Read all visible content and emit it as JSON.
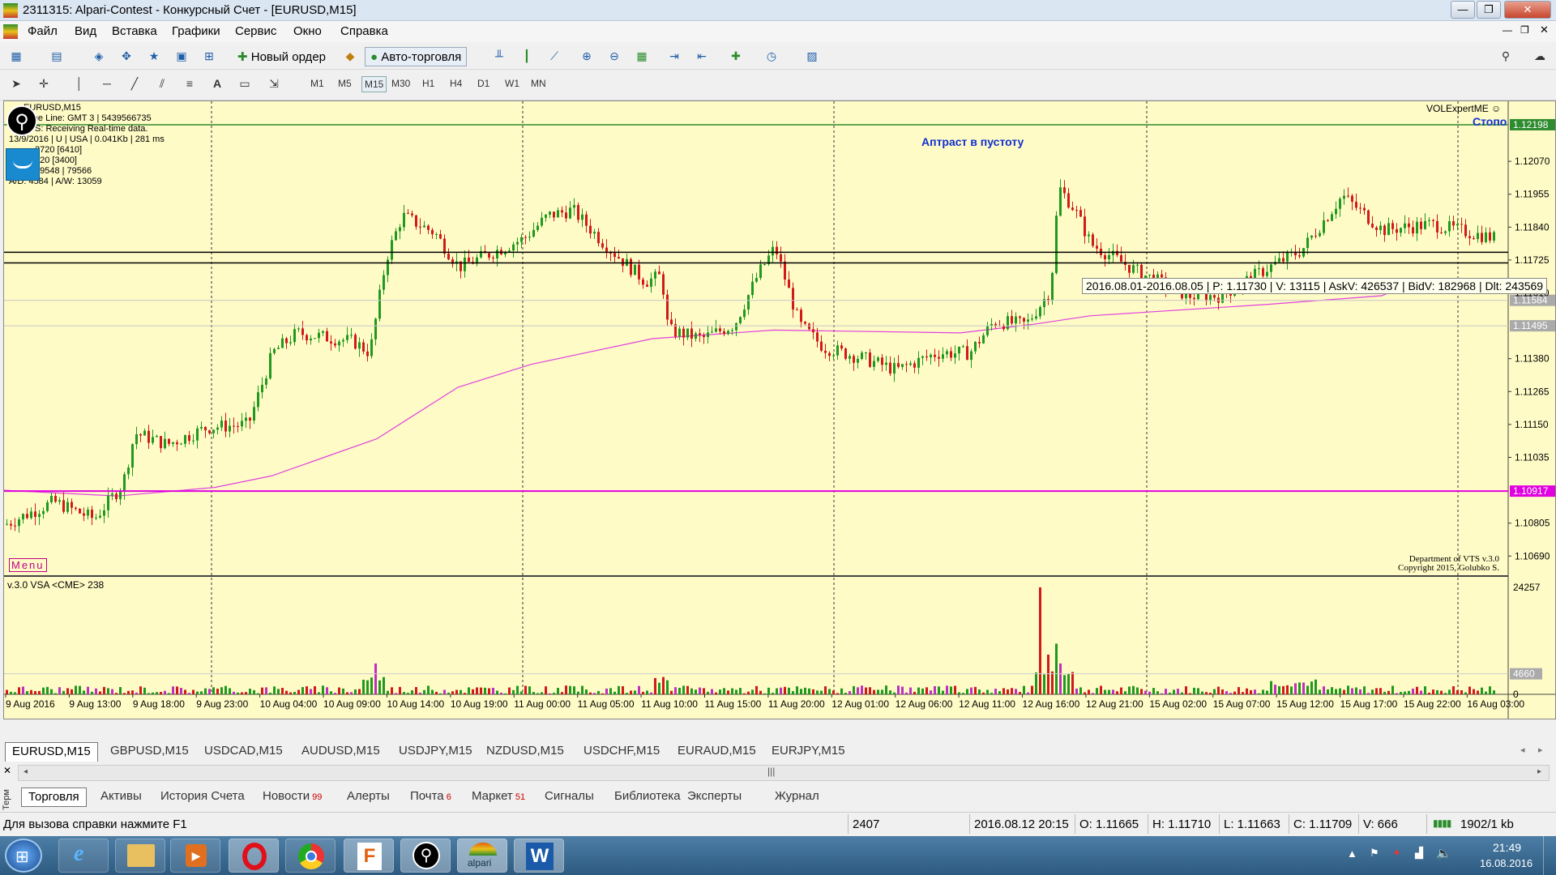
{
  "window": {
    "title": "2311315: Alpari-Contest - Конкурсный Счет - [EURUSD,M15]",
    "controls": [
      "—",
      "❐",
      "✕"
    ]
  },
  "menu": [
    "Файл",
    "Вид",
    "Вставка",
    "Графики",
    "Сервис",
    "Окно",
    "Справка"
  ],
  "toolbar": {
    "new_order": "Новый ордер",
    "auto_trading": "Авто-торговля",
    "timeframes": [
      "M1",
      "M5",
      "M15",
      "M30",
      "H1",
      "H4",
      "D1",
      "W1",
      "MN"
    ],
    "selected_timeframe": "M15",
    "text_tool": "A"
  },
  "chart": {
    "symbol_header": "EURUSD,M15",
    "info_lines": [
      "Time Line: GMT 3 | 5439566735",
      "VTS:  Receiving Real-time data.",
      "13/9/2016 | U | USA | 0.041Kb | 281 ms",
      "2720  [6410]",
      "620  [3400]",
      "99548 | 79566",
      "A/D: 4584 | A/W: 13059"
    ],
    "menu_label": "Menu",
    "top_right_label": "VOLExpertME ☺",
    "stop_label": "Стопо",
    "annotation": "Аптраст в пустоту",
    "tooltip": "2016.08.01-2016.08.05 | P: 1.11730 | V: 13115 | AskV: 426537 | BidV: 182968 | Dlt: 243569",
    "copyright_1": "Department of VTS  v.3.0",
    "copyright_2": "Copyright 2015, Golubko S.",
    "indicator_label": "v.3.0 VSA <CME> 238",
    "price_labels": [
      "1.12070",
      "1.11955",
      "1.11840",
      "1.11725",
      "1.11610",
      "1.11380",
      "1.11265",
      "1.11150",
      "1.11035",
      "1.10805",
      "1.10690"
    ],
    "highlight_prices": {
      "top_line": "1.12198",
      "magenta_line": "1.10917",
      "grey_1": "1.11584",
      "grey_2": "1.11495"
    },
    "volume_labels": [
      "24257",
      "4660",
      "0"
    ],
    "time_labels": [
      "9 Aug 2016",
      "9 Aug 13:00",
      "9 Aug 18:00",
      "9 Aug 23:00",
      "10 Aug 04:00",
      "10 Aug 09:00",
      "10 Aug 14:00",
      "10 Aug 19:00",
      "11 Aug 00:00",
      "11 Aug 05:00",
      "11 Aug 10:00",
      "11 Aug 15:00",
      "11 Aug 20:00",
      "12 Aug 01:00",
      "12 Aug 06:00",
      "12 Aug 11:00",
      "12 Aug 16:00",
      "12 Aug 21:00",
      "15 Aug 02:00",
      "15 Aug 07:00",
      "15 Aug 12:00",
      "15 Aug 17:00",
      "15 Aug 22:00",
      "16 Aug 03:00"
    ],
    "colors": {
      "background": "#fffbc6",
      "bull": "#1f9a1f",
      "bear": "#d11a1a",
      "ma": "#e040e0",
      "magenta_line": "#e000e0",
      "top_line": "#2e8b2e",
      "annotation": "#1030d0"
    }
  },
  "chart_tabs": [
    "EURUSD,M15",
    "GBPUSD,M15",
    "USDCAD,M15",
    "AUDUSD,M15",
    "USDJPY,M15",
    "NZDUSD,M15",
    "USDCHF,M15",
    "EURAUD,M15",
    "EURJPY,M15"
  ],
  "terminal": {
    "side_label": "Терм",
    "tabs": [
      {
        "label": "Торговля",
        "badge": ""
      },
      {
        "label": "Активы",
        "badge": ""
      },
      {
        "label": "История Счета",
        "badge": ""
      },
      {
        "label": "Новости",
        "badge": "99"
      },
      {
        "label": "Алерты",
        "badge": ""
      },
      {
        "label": "Почта",
        "badge": "6"
      },
      {
        "label": "Маркет",
        "badge": "51"
      },
      {
        "label": "Сигналы",
        "badge": ""
      },
      {
        "label": "Библиотека",
        "badge": ""
      },
      {
        "label": "Эксперты",
        "badge": ""
      },
      {
        "label": "Журнал",
        "badge": ""
      }
    ]
  },
  "status": {
    "help": "Для вызова справки нажмите F1",
    "bars": "2407",
    "datetime": "2016.08.12 20:15",
    "open": "O: 1.11665",
    "high": "H: 1.11710",
    "low": "L: 1.11663",
    "close": "C: 1.11709",
    "volume": "V: 666",
    "traffic": "1902/1 kb"
  },
  "taskbar": {
    "apps": [
      "start-button",
      "internet-explorer-icon",
      "file-explorer-icon",
      "media-player-icon",
      "opera-icon",
      "chrome-icon",
      "app-f-icon",
      "keyhole-app-icon",
      "alpari-icon",
      "word-icon"
    ],
    "alpari_label": "alpari",
    "time": "21:49",
    "date": "16.08.2016"
  }
}
